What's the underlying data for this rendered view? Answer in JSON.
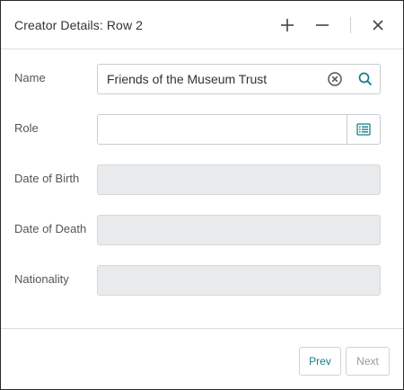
{
  "dialog": {
    "title": "Creator Details: Row 2"
  },
  "fields": {
    "name": {
      "label": "Name",
      "value": "Friends of the Museum Trust"
    },
    "role": {
      "label": "Role",
      "value": ""
    },
    "date_of_birth": {
      "label": "Date of Birth",
      "value": ""
    },
    "date_of_death": {
      "label": "Date of Death",
      "value": ""
    },
    "nationality": {
      "label": "Nationality",
      "value": ""
    }
  },
  "footer": {
    "prev_label": "Prev",
    "next_label": "Next"
  },
  "colors": {
    "accent": "#177e89",
    "disabled_fill": "#e8eaec",
    "muted_text": "#9a9a9a"
  },
  "icons": {
    "add": "plus-icon",
    "minimize": "minus-icon",
    "close": "close-icon",
    "clear": "clear-circle-icon",
    "search": "search-icon",
    "list": "list-icon"
  }
}
